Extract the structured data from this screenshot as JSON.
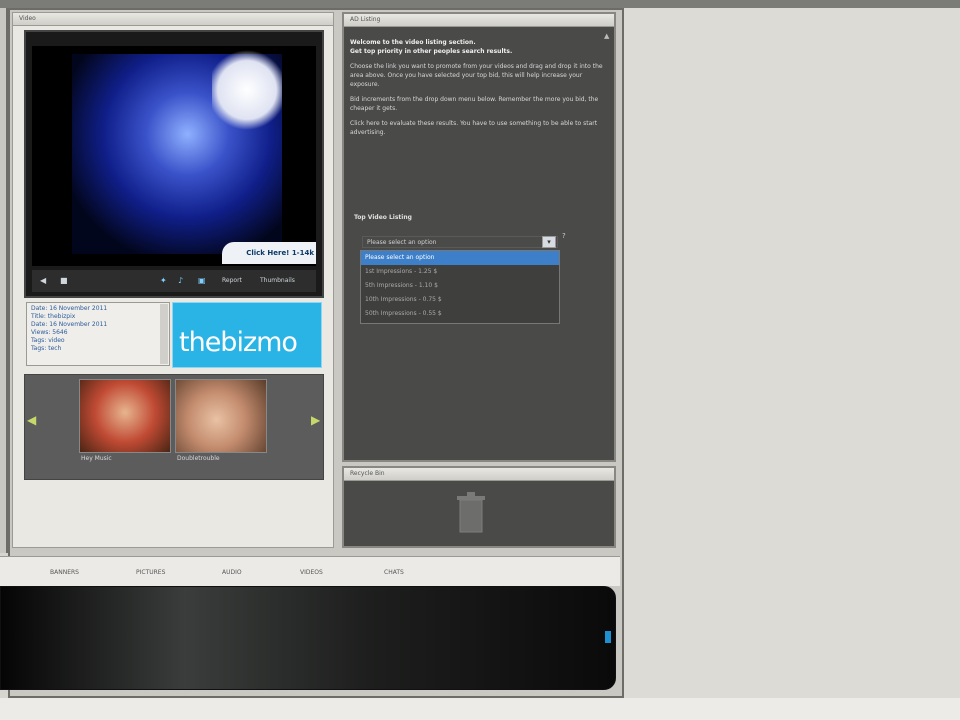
{
  "media_panel": {
    "title": "Video",
    "video": {
      "caption": "Click Here! 1-14k"
    },
    "controls": {
      "prev_label": "◀",
      "play_label": "■",
      "link1": "Report",
      "link2": "Thumbnails"
    },
    "info_lines": [
      "Date: 16 November 2011",
      "Title: thebizpix",
      "Date: 16 November 2011",
      "Views: 5646",
      "Tags: video",
      "Tags: tech"
    ],
    "logo_text": "thebizmo",
    "thumbnails": [
      {
        "label": "Hey Music"
      },
      {
        "label": "Doubletrouble"
      }
    ]
  },
  "listing_panel": {
    "title": "AD Listing",
    "heading1": "Welcome to the video listing section.",
    "heading2": "Get top priority in other peoples search results.",
    "para1": "Choose the link you want to promote from your videos and drag and drop it into the area above. Once you have selected your top bid, this will help increase your exposure.",
    "para2": "Bid increments from the drop down menu below. Remember the more you bid, the cheaper it gets.",
    "para3": "Click here to evaluate these results. You have to use something to be able to start advertising.",
    "bid_label": "Top Video Listing",
    "select_placeholder": "Please select an option",
    "help": "?",
    "options": [
      "Please select an option",
      "1st Impressions - 1.25 $",
      "5th Impressions - 1.10 $",
      "10th Impressions - 0.75 $",
      "50th Impressions - 0.55 $"
    ],
    "selected_index": 0
  },
  "budget_panel": {
    "title": "Recycle Bin"
  },
  "category_bar": {
    "items": [
      "BANNERS",
      "PICTURES",
      "AUDIO",
      "VIDEOS",
      "CHATS"
    ]
  },
  "colors": {
    "accent_blue": "#2ab4e6",
    "dropdown_selected": "#3e7fc9",
    "panel_dark": "#4a4a49"
  }
}
